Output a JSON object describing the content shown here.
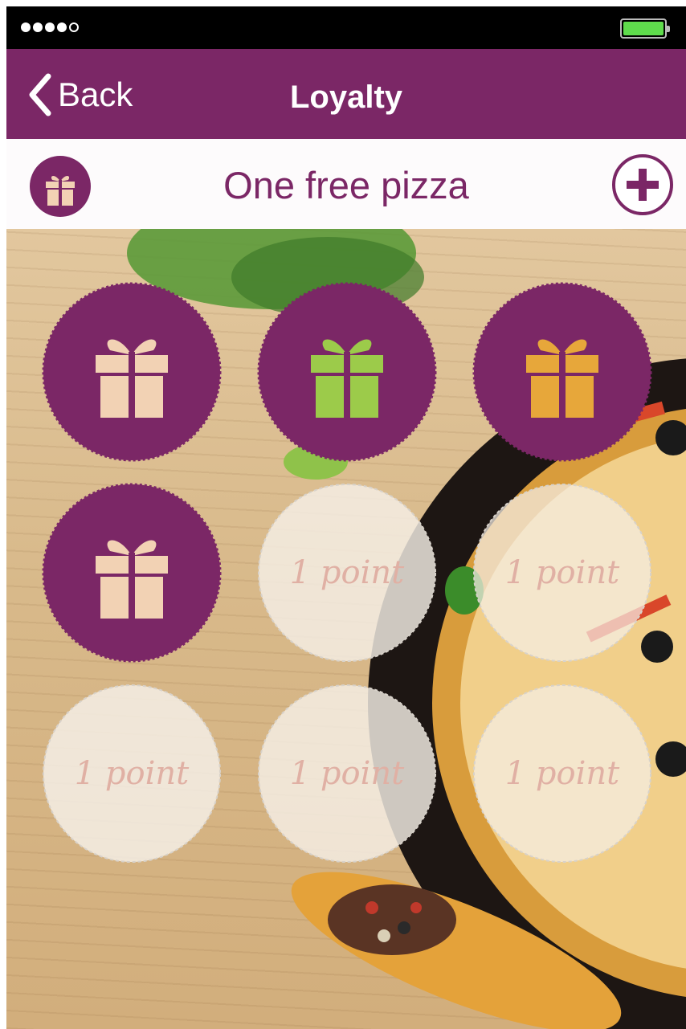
{
  "status_bar": {
    "signal_dots": 5,
    "signal_filled": 4,
    "battery": "full"
  },
  "nav": {
    "back_label": "Back",
    "title": "Loyalty"
  },
  "reward": {
    "title": "One free pizza",
    "badge_icon": "gift-icon",
    "add_icon": "plus-circle-icon"
  },
  "stamps": [
    {
      "collected": true
    },
    {
      "collected": true
    },
    {
      "collected": true
    },
    {
      "collected": true
    },
    {
      "collected": false,
      "label": "1 point"
    },
    {
      "collected": false,
      "label": "1 point"
    },
    {
      "collected": false,
      "label": "1 point"
    },
    {
      "collected": false,
      "label": "1 point"
    },
    {
      "collected": false,
      "label": "1 point"
    }
  ],
  "colors": {
    "brand": "#7b2766",
    "gift": "#f2d2b4",
    "stamp_empty": "#f5efe6",
    "point_text": "#e0b0a4",
    "battery": "#5fdc4c"
  }
}
